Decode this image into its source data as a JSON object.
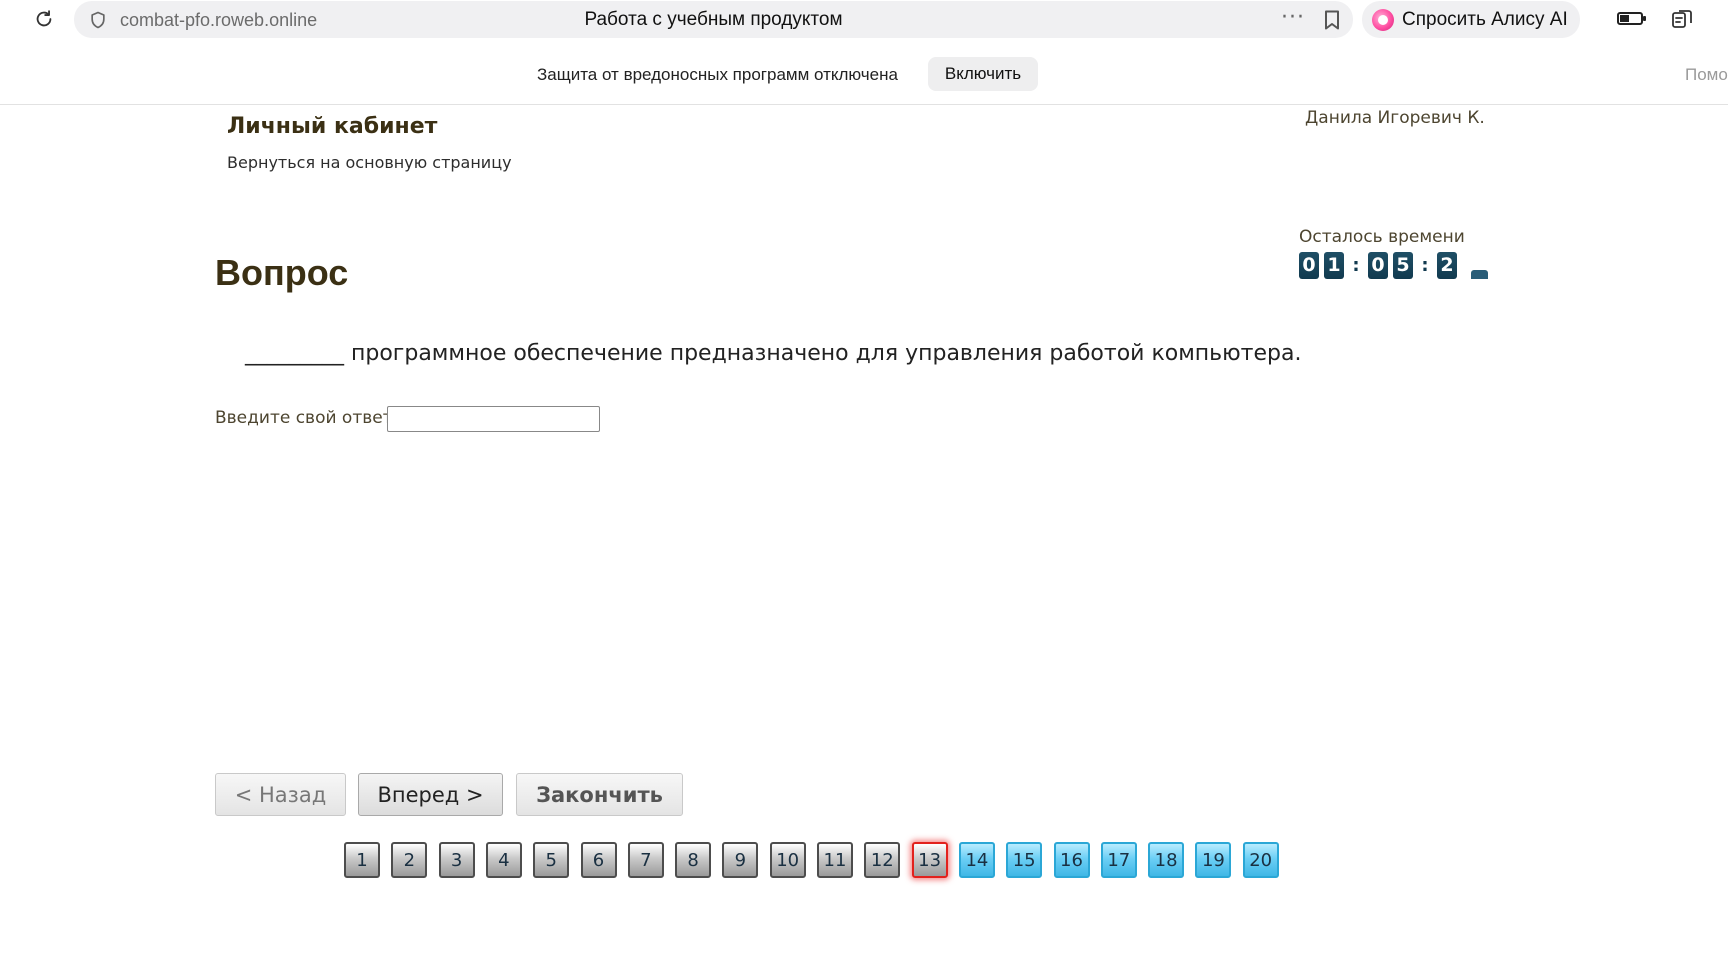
{
  "browser": {
    "url": "combat-pfo.roweb.online",
    "tab_title": "Работа с учебным продуктом",
    "more_dots": "···",
    "alice_label": "Спросить Алису AI"
  },
  "security_notice": {
    "text": "Защита от вредоносных программ отключена",
    "enable_label": "Включить",
    "help_label": "Помощь"
  },
  "header": {
    "cabinet_title": "Личный кабинет",
    "back_link": "Вернуться на основную страницу",
    "user_name": "Данила Игоревич К."
  },
  "timer": {
    "label": "Осталось времени",
    "digits": [
      "0",
      "1",
      "0",
      "5",
      "2"
    ],
    "separator": ":"
  },
  "question": {
    "heading": "Вопрос",
    "text": "_________ программное обеспечение предназначено для управления работой компьютера.",
    "answer_label": "Введите свой ответ",
    "answer_value": ""
  },
  "navigation": {
    "back_label": "< Назад",
    "next_label": "Вперед >",
    "finish_label": "Закончить"
  },
  "pager": {
    "numbers": [
      "1",
      "2",
      "3",
      "4",
      "5",
      "6",
      "7",
      "8",
      "9",
      "10",
      "11",
      "12",
      "13",
      "14",
      "15",
      "16",
      "17",
      "18",
      "19",
      "20"
    ],
    "current": 13,
    "answered_through": 12
  },
  "colors": {
    "heading": "#3b3014",
    "timer_digit_bg": "#113a4f",
    "pager_done": "#9a9a9a",
    "pager_todo": "#3fb7e6",
    "pager_current_border": "#e2211c"
  }
}
